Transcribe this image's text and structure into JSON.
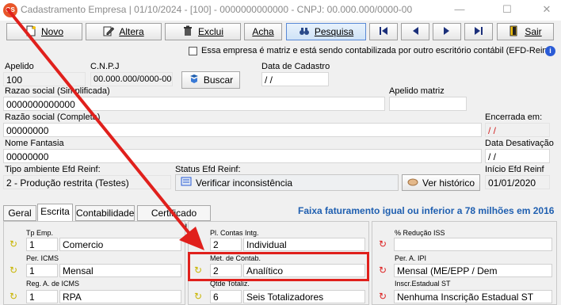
{
  "window": {
    "title": "Cadastramento Empresa | 01/10/2024 - [100] - 0000000000000 - CNPJ: 00.000.000/0000-00",
    "app_badge": "GS"
  },
  "toolbar": {
    "novo": "Novo",
    "altera": "Altera",
    "exclui": "Exclui",
    "acha": "Acha",
    "pesquisa": "Pesquisa",
    "sair": "Sair"
  },
  "matriz_checkbox_label": "Essa empresa é matriz e está sendo contabilizada por outro escritório contábil (EFD-Reinf",
  "form": {
    "apelido_label": "Apelido",
    "apelido_value": "100",
    "cnpj_label": "C.N.P.J",
    "cnpj_value": "00.000.000/0000-00",
    "buscar": "Buscar",
    "data_cadastro_label": "Data de Cadastro",
    "data_cadastro_value": " / /",
    "razao_simpl_label": "Razao social (Simplificada)",
    "razao_simpl_value": "0000000000000",
    "apelido_matriz_label": "Apelido matriz",
    "razao_completa_label": "Razão social (Completa)",
    "razao_completa_value": "00000000",
    "encerrada_label": "Encerrada em:",
    "encerrada_value": " / /",
    "nome_fantasia_label": "Nome Fantasia",
    "nome_fantasia_value": "00000000",
    "data_desativacao_label": "Data Desativação",
    "data_desativacao_value": " / /",
    "tipo_ambiente_label": "Tipo ambiente Efd Reinf:",
    "tipo_ambiente_value": "2 - Produção restrita (Testes)",
    "status_label": "Status Efd Reinf:",
    "verificar": "Verificar inconsistência",
    "ver_historico": "Ver histórico",
    "inicio_label": "Início Efd Reinf",
    "inicio_value": "01/01/2020"
  },
  "tabs": {
    "geral": "Geral",
    "escrita": "Escrita",
    "contabilidade": "Contabilidade",
    "certificado": "Certificado Digital",
    "faixa_info": "Faixa faturamento igual ou inferior a 78 milhões em 2016"
  },
  "escrita": {
    "tp_emp_label": "Tp Emp.",
    "tp_emp_code": "1",
    "tp_emp_value": "Comercio",
    "per_icms_label": "Per. ICMS",
    "per_icms_code": "1",
    "per_icms_value": "Mensal",
    "reg_icms_label": "Reg. A. de ICMS",
    "reg_icms_code": "1",
    "reg_icms_value": "RPA",
    "pl_contas_label": "Pl. Contas Intg.",
    "pl_contas_code": "2",
    "pl_contas_value": "Individual",
    "met_contab_label": "Met. de Contab.",
    "met_contab_code": "2",
    "met_contab_value": "Analítico",
    "qtde_label": "Qtde Totaliz.",
    "qtde_code": "6",
    "qtde_value": "Seis Totalizadores",
    "reducao_label": "% Redução ISS",
    "per_ipi_label": "Per. A. IPI",
    "per_ipi_value": "Mensal (ME/EPP / Dem",
    "inscr_label": "Inscr.Estadual ST",
    "inscr_value": "Nenhuma Inscrição Estadual ST"
  },
  "colors": {
    "highlight": "#e0201c",
    "faixa_text": "#1f5fb0",
    "red_date": "#d22222"
  }
}
